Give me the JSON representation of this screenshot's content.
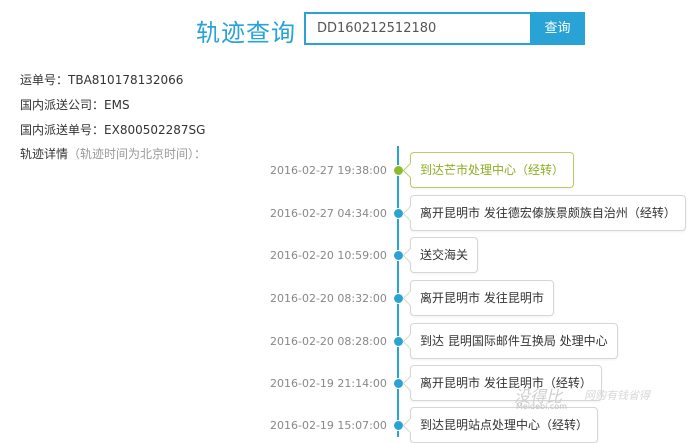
{
  "header": {
    "title": "轨迹查询",
    "search_value": "DD160212512180",
    "search_button": "查询"
  },
  "info": {
    "waybill_label": "运单号：",
    "waybill_value": "TBA810178132066",
    "carrier_label": "国内派送公司：",
    "carrier_value": "EMS",
    "domestic_no_label": "国内派送单号：",
    "domestic_no_value": "EX800502287SG",
    "detail_label": "轨迹详情",
    "detail_note": "（轨迹时间为北京时间）："
  },
  "events": [
    {
      "time": "2016-02-27 19:38:00",
      "text": "到达芒市处理中心（经转）",
      "active": true
    },
    {
      "time": "2016-02-27 04:34:00",
      "text": "离开昆明市 发往德宏傣族景颇族自治州（经转）",
      "active": false
    },
    {
      "time": "2016-02-20 10:59:00",
      "text": "送交海关",
      "active": false
    },
    {
      "time": "2016-02-20 08:32:00",
      "text": "离开昆明市 发往昆明市",
      "active": false
    },
    {
      "time": "2016-02-20 08:28:00",
      "text": "到达 昆明国际邮件互换局 处理中心",
      "active": false
    },
    {
      "time": "2016-02-19 21:14:00",
      "text": "离开昆明市 发往昆明市（经转）",
      "active": false
    },
    {
      "time": "2016-02-19 15:07:00",
      "text": "到达昆明站点处理中心（经转）",
      "active": false
    }
  ],
  "colors": {
    "accent": "#29a3d6",
    "active": "#8dbb2f"
  },
  "watermark": {
    "logo": "没得比",
    "domain": "Meidebi.com",
    "slogan": "网购有钱省得"
  }
}
